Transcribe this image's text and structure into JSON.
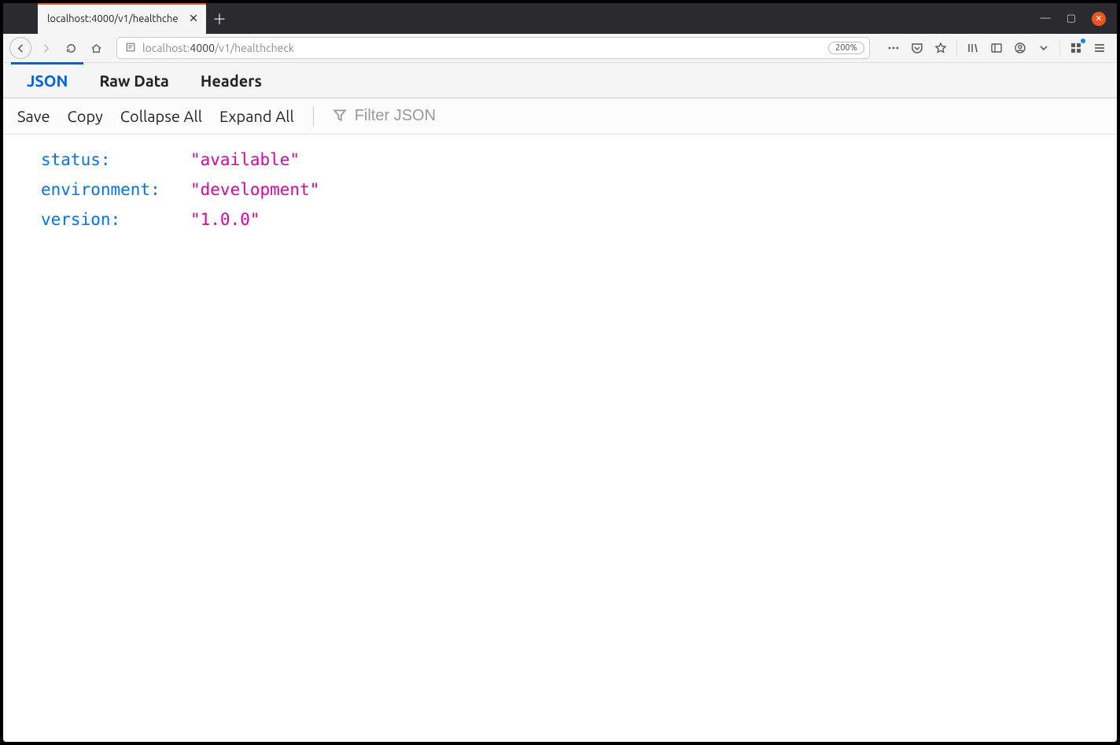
{
  "tab": {
    "title": "localhost:4000/v1/healthche"
  },
  "url": {
    "host_dim": "localhost:",
    "host_bold": "4000",
    "path": "/v1/healthcheck",
    "zoom": "200%"
  },
  "viewer_tabs": {
    "json": "JSON",
    "raw": "Raw Data",
    "headers": "Headers"
  },
  "toolbar": {
    "save": "Save",
    "copy": "Copy",
    "collapse": "Collapse All",
    "expand": "Expand All",
    "filter_placeholder": "Filter JSON"
  },
  "json": {
    "rows": [
      {
        "key": "status:",
        "value": "\"available\""
      },
      {
        "key": "environment:",
        "value": "\"development\""
      },
      {
        "key": "version:",
        "value": "\"1.0.0\""
      }
    ]
  }
}
